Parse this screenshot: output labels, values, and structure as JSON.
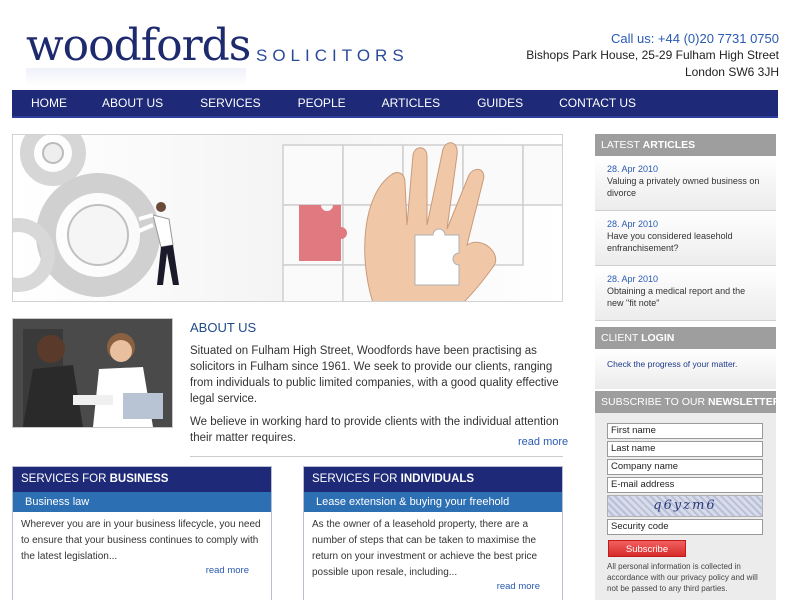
{
  "header": {
    "logo_main": "woodfords",
    "logo_sub": "SOLICITORS",
    "phone": "Call us: +44 (0)20 7731 0750",
    "address_line1": "Bishops Park House, 25-29 Fulham High Street",
    "address_line2": "London SW6 3JH"
  },
  "nav": {
    "items": [
      "HOME",
      "ABOUT US",
      "SERVICES",
      "PEOPLE",
      "ARTICLES",
      "GUIDES",
      "CONTACT US"
    ]
  },
  "about": {
    "title": "ABOUT US",
    "paragraph1": "Situated on Fulham High Street, Woodfords have been practising as solicitors in Fulham since 1961. We seek to provide our clients, ranging from individuals to public limited companies, with a good quality effective legal service.",
    "paragraph2": "We believe in working hard to provide clients with the individual attention their matter requires.",
    "read_more": "read more"
  },
  "services_business": {
    "head_prefix": "SERVICES FOR ",
    "head_bold": "BUSINESS",
    "sub": "Business law",
    "body": "Wherever you are in your business lifecycle, you need to ensure that your business continues to comply with the latest legislation...",
    "read_more": "read more"
  },
  "services_individuals": {
    "head_prefix": "SERVICES FOR ",
    "head_bold": "INDIVIDUALS",
    "sub": "Lease extension & buying your freehold",
    "body": "As the owner of a leasehold property, there are a number of steps that can be taken to maximise the return on your investment or achieve the best price possible upon resale, including...",
    "read_more": "read more"
  },
  "sidebar": {
    "latest_prefix": "LATEST ",
    "latest_bold": "ARTICLES",
    "articles": [
      {
        "date": "28. Apr 2010",
        "title": "Valuing a privately owned business on divorce"
      },
      {
        "date": "28. Apr 2010",
        "title": "Have you considered leasehold enfranchisement?"
      },
      {
        "date": "28. Apr 2010",
        "title": "Obtaining a medical report and the new \"fit note\""
      }
    ],
    "client_prefix": "CLIENT ",
    "client_bold": "LOGIN",
    "client_link": "Check the progress of your matter.",
    "newsletter_prefix": "SUBSCRIBE TO OUR ",
    "newsletter_bold": "NEWSLETTER",
    "fields": {
      "first_name": "First name",
      "last_name": "Last name",
      "company": "Company name",
      "email": "E-mail address",
      "security_code": "Security code"
    },
    "captcha_text": "q6yzm6",
    "subscribe_label": "Subscribe",
    "privacy": "All personal information is collected in accordance with our privacy policy and will not be passed to any third parties."
  },
  "colors": {
    "navy": "#1e2a78",
    "blue_sub": "#2d6fb3",
    "link": "#2a5ab2",
    "sidebar_head": "#9e9e9e",
    "subscribe": "#d72a2a"
  }
}
